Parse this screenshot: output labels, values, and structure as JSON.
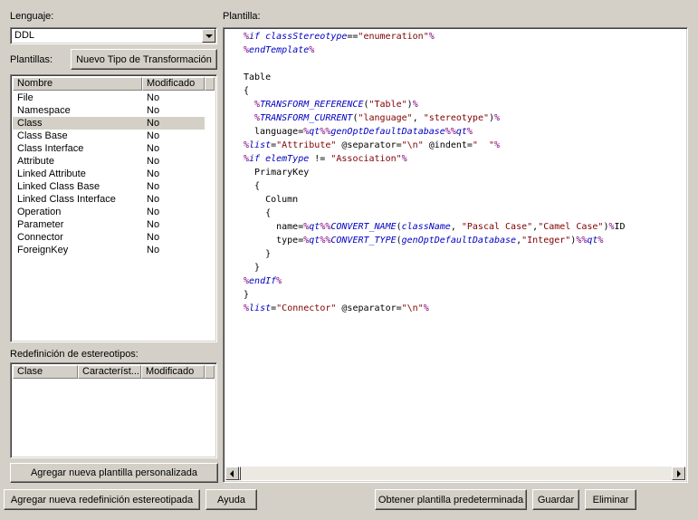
{
  "left": {
    "language_label": "Lenguaje:",
    "language_value": "DDL",
    "templates_label": "Plantillas:",
    "new_transform_button": "Nuevo Tipo de Transformación",
    "templates_columns": [
      "Nombre",
      "Modificado"
    ],
    "templates": [
      {
        "name": "File",
        "modified": "No"
      },
      {
        "name": "Namespace",
        "modified": "No"
      },
      {
        "name": "Class",
        "modified": "No",
        "selected": true
      },
      {
        "name": "Class Base",
        "modified": "No"
      },
      {
        "name": "Class Interface",
        "modified": "No"
      },
      {
        "name": "Attribute",
        "modified": "No"
      },
      {
        "name": "Linked Attribute",
        "modified": "No"
      },
      {
        "name": "Linked Class Base",
        "modified": "No"
      },
      {
        "name": "Linked Class Interface",
        "modified": "No"
      },
      {
        "name": "Operation",
        "modified": "No"
      },
      {
        "name": "Parameter",
        "modified": "No"
      },
      {
        "name": "Connector",
        "modified": "No"
      },
      {
        "name": "ForeignKey",
        "modified": "No"
      }
    ],
    "stereo_label": "Redefinición de estereotipos:",
    "stereo_columns": [
      "Clase",
      "Característ...",
      "Modificado"
    ],
    "add_custom_button": "Agregar nueva plantilla personalizada"
  },
  "editor": {
    "label": "Plantilla:",
    "lines": [
      [
        [
          "pct",
          "%"
        ],
        [
          "kw",
          "if classStereotype"
        ],
        [
          "txt",
          "=="
        ],
        [
          "str",
          "\"enumeration\""
        ],
        [
          "pct",
          "%"
        ]
      ],
      [
        [
          "pct",
          "%"
        ],
        [
          "kw",
          "endTemplate"
        ],
        [
          "pct",
          "%"
        ]
      ],
      [
        [
          "txt",
          ""
        ]
      ],
      [
        [
          "txt",
          "Table"
        ]
      ],
      [
        [
          "txt",
          "{"
        ]
      ],
      [
        [
          "txt",
          "  "
        ],
        [
          "pct",
          "%"
        ],
        [
          "fn",
          "TRANSFORM_REFERENCE"
        ],
        [
          "txt",
          "("
        ],
        [
          "str",
          "\"Table\""
        ],
        [
          "txt",
          ")"
        ],
        [
          "pct",
          "%"
        ]
      ],
      [
        [
          "txt",
          "  "
        ],
        [
          "pct",
          "%"
        ],
        [
          "fn",
          "TRANSFORM_CURRENT"
        ],
        [
          "txt",
          "("
        ],
        [
          "str",
          "\"language\""
        ],
        [
          "txt",
          ", "
        ],
        [
          "str",
          "\"stereotype\""
        ],
        [
          "txt",
          ")"
        ],
        [
          "pct",
          "%"
        ]
      ],
      [
        [
          "txt",
          "  language="
        ],
        [
          "pct",
          "%"
        ],
        [
          "kw",
          "qt"
        ],
        [
          "pct",
          "%%"
        ],
        [
          "kw",
          "genOptDefaultDatabase"
        ],
        [
          "pct",
          "%%"
        ],
        [
          "kw",
          "qt"
        ],
        [
          "pct",
          "%"
        ]
      ],
      [
        [
          "pct",
          "%"
        ],
        [
          "kw",
          "list"
        ],
        [
          "txt",
          "="
        ],
        [
          "str",
          "\"Attribute\""
        ],
        [
          "txt",
          " @separator="
        ],
        [
          "str",
          "\"\\n\""
        ],
        [
          "txt",
          " @indent="
        ],
        [
          "str",
          "\"  \""
        ],
        [
          "pct",
          "%"
        ]
      ],
      [
        [
          "pct",
          "%"
        ],
        [
          "kw",
          "if elemType"
        ],
        [
          "txt",
          " != "
        ],
        [
          "str",
          "\"Association\""
        ],
        [
          "pct",
          "%"
        ]
      ],
      [
        [
          "txt",
          "  PrimaryKey"
        ]
      ],
      [
        [
          "txt",
          "  {"
        ]
      ],
      [
        [
          "txt",
          "    Column"
        ]
      ],
      [
        [
          "txt",
          "    {"
        ]
      ],
      [
        [
          "txt",
          "      name="
        ],
        [
          "pct",
          "%"
        ],
        [
          "kw",
          "qt"
        ],
        [
          "pct",
          "%%"
        ],
        [
          "fn",
          "CONVERT_NAME"
        ],
        [
          "txt",
          "("
        ],
        [
          "kw",
          "className"
        ],
        [
          "txt",
          ", "
        ],
        [
          "str",
          "\"Pascal Case\""
        ],
        [
          "txt",
          ","
        ],
        [
          "str",
          "\"Camel Case\""
        ],
        [
          "txt",
          ")"
        ],
        [
          "pct",
          "%"
        ],
        [
          "txt",
          "ID"
        ]
      ],
      [
        [
          "txt",
          "      type="
        ],
        [
          "pct",
          "%"
        ],
        [
          "kw",
          "qt"
        ],
        [
          "pct",
          "%%"
        ],
        [
          "fn",
          "CONVERT_TYPE"
        ],
        [
          "txt",
          "("
        ],
        [
          "kw",
          "genOptDefaultDatabase"
        ],
        [
          "txt",
          ","
        ],
        [
          "str",
          "\"Integer\""
        ],
        [
          "txt",
          ")"
        ],
        [
          "pct",
          "%%"
        ],
        [
          "kw",
          "qt"
        ],
        [
          "pct",
          "%"
        ]
      ],
      [
        [
          "txt",
          "    }"
        ]
      ],
      [
        [
          "txt",
          "  }"
        ]
      ],
      [
        [
          "pct",
          "%"
        ],
        [
          "kw",
          "endIf"
        ],
        [
          "pct",
          "%"
        ]
      ],
      [
        [
          "txt",
          "}"
        ]
      ],
      [
        [
          "pct",
          "%"
        ],
        [
          "kw",
          "list"
        ],
        [
          "txt",
          "="
        ],
        [
          "str",
          "\"Connector\""
        ],
        [
          "txt",
          " @separator="
        ],
        [
          "str",
          "\"\\n\""
        ],
        [
          "pct",
          "%"
        ]
      ]
    ]
  },
  "bottom": {
    "add_stereo_button": "Agregar nueva redefinición estereotipada",
    "help_button": "Ayuda",
    "default_button": "Obtener plantilla predeterminada",
    "save_button": "Guardar",
    "delete_button": "Eliminar"
  }
}
